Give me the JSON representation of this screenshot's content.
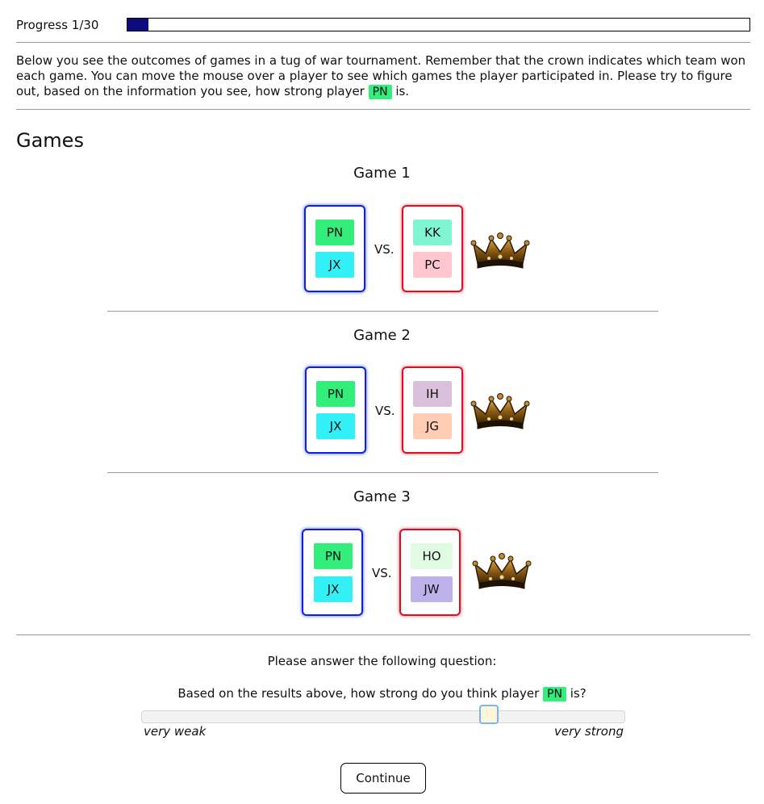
{
  "progress": {
    "label": "Progress 1/30",
    "fraction": 0.0333
  },
  "intro": {
    "text_before": "Below you see the outcomes of games in a tug of war tournament. Remember that the crown indicates which team won each game. You can move the mouse over a player to see which games the player participated in. Please try to figure out, based on the information you see, how strong player ",
    "player": "PN",
    "text_after": " is."
  },
  "games_heading": "Games",
  "vs_label": "VS.",
  "games": [
    {
      "title": "Game 1",
      "winner": "right",
      "left_team": [
        {
          "name": "PN",
          "color": "#33ee7a"
        },
        {
          "name": "JX",
          "color": "#33f0f6"
        }
      ],
      "right_team": [
        {
          "name": "KK",
          "color": "#80f5d2"
        },
        {
          "name": "PC",
          "color": "#ffc6d0"
        }
      ]
    },
    {
      "title": "Game 2",
      "winner": "right",
      "left_team": [
        {
          "name": "PN",
          "color": "#33ee7a"
        },
        {
          "name": "JX",
          "color": "#33f0f6"
        }
      ],
      "right_team": [
        {
          "name": "IH",
          "color": "#d9c1dc"
        },
        {
          "name": "JG",
          "color": "#ffcdb4"
        }
      ]
    },
    {
      "title": "Game 3",
      "winner": "right",
      "left_team": [
        {
          "name": "PN",
          "color": "#33ee7a"
        },
        {
          "name": "JX",
          "color": "#33f0f6"
        }
      ],
      "right_team": [
        {
          "name": "HO",
          "color": "#e0fde4"
        },
        {
          "name": "JW",
          "color": "#bdb3ea"
        }
      ]
    }
  ],
  "question": {
    "label": "Please answer the following question:",
    "text_before": "Based on the results above, how strong do you think player ",
    "player": "PN",
    "text_after": " is?"
  },
  "slider": {
    "value": 0.72,
    "low_label": "very weak",
    "high_label": "very strong"
  },
  "continue_label": "Continue",
  "colors": {
    "chip": "#33ee7a",
    "progress_fill": "#0b0b80",
    "team_left": "#1020d8",
    "team_right": "#d81020",
    "slider_handle_border": "#7db4ee"
  }
}
